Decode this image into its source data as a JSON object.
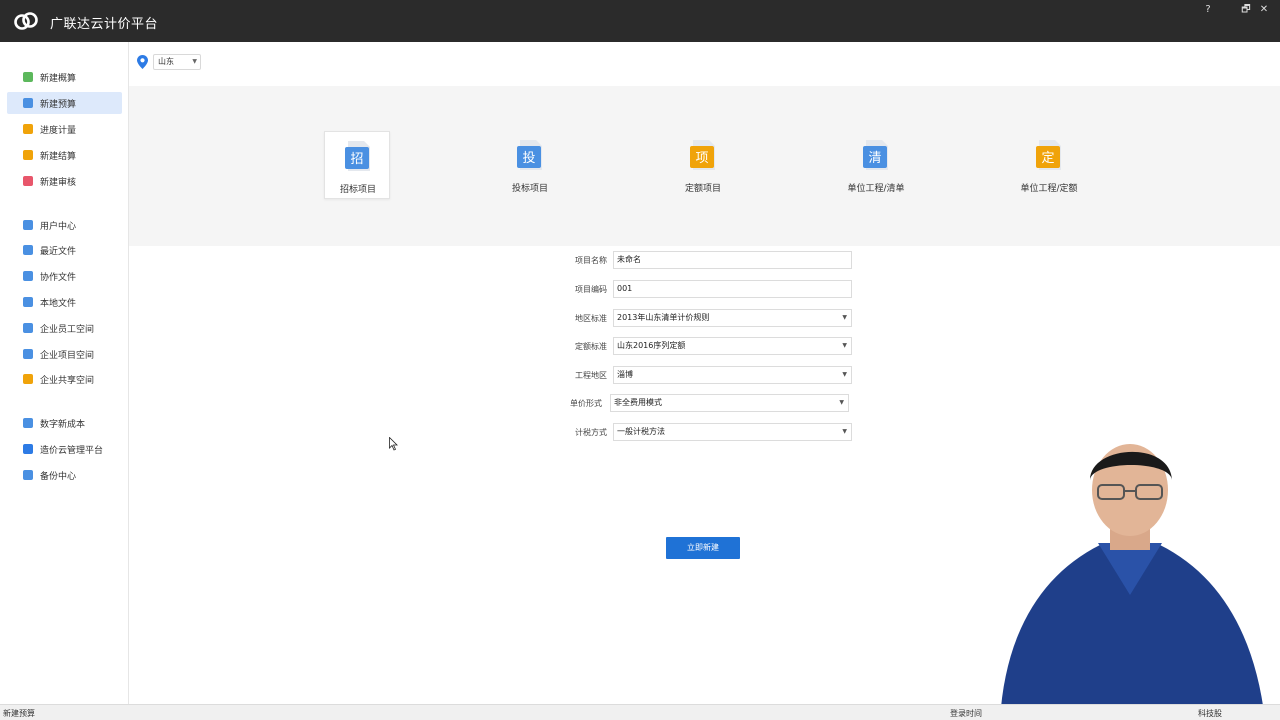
{
  "app": {
    "title": "广联达云计价平台",
    "help_label": "?",
    "restore_label": "🗗",
    "close_label": "✕"
  },
  "sidebar": {
    "items": [
      {
        "label": "新建概算",
        "color": "#5cb85c"
      },
      {
        "label": "新建预算",
        "color": "#4a90e2"
      },
      {
        "label": "进度计量",
        "color": "#f0a30a"
      },
      {
        "label": "新建结算",
        "color": "#f0a30a"
      },
      {
        "label": "新建审核",
        "color": "#e8566b"
      },
      {
        "label": "用户中心",
        "color": "#4a90e2"
      },
      {
        "label": "最近文件",
        "color": "#4a90e2"
      },
      {
        "label": "协作文件",
        "color": "#4a90e2"
      },
      {
        "label": "本地文件",
        "color": "#4a90e2"
      },
      {
        "label": "企业员工空间",
        "color": "#4a90e2"
      },
      {
        "label": "企业项目空间",
        "color": "#4a90e2"
      },
      {
        "label": "企业共享空间",
        "color": "#f0a30a"
      },
      {
        "label": "数字新成本",
        "color": "#4a90e2"
      },
      {
        "label": "造价云管理平台",
        "color": "#2d7be5"
      },
      {
        "label": "备份中心",
        "color": "#4a90e2"
      }
    ]
  },
  "region": {
    "selected": "山东",
    "arrow": "▼"
  },
  "project_types": [
    {
      "label": "招标项目",
      "glyph": "招",
      "color": "#4a90e2"
    },
    {
      "label": "投标项目",
      "glyph": "投",
      "color": "#4a90e2"
    },
    {
      "label": "定额项目",
      "glyph": "项",
      "color": "#f0a30a"
    },
    {
      "label": "单位工程/清单",
      "glyph": "清",
      "color": "#4a90e2"
    },
    {
      "label": "单位工程/定额",
      "glyph": "定",
      "color": "#f0a30a"
    }
  ],
  "form": {
    "fields": [
      {
        "label": "项目名称",
        "value": "未命名",
        "dropdown": false
      },
      {
        "label": "项目编码",
        "value": "001",
        "dropdown": false
      },
      {
        "label": "地区标准",
        "value": "2013年山东清单计价规则",
        "dropdown": true
      },
      {
        "label": "定额标准",
        "value": "山东2016序列定额",
        "dropdown": true
      },
      {
        "label": "工程地区",
        "value": "淄博",
        "dropdown": true
      },
      {
        "label": "单价形式",
        "value": "非全费用模式",
        "dropdown": true
      },
      {
        "label": "计税方式",
        "value": "一般计税方法",
        "dropdown": true
      }
    ],
    "arrow": "▼",
    "create_button": "立即新建"
  },
  "statusbar": {
    "left": "新建预算",
    "mid": "登录时间",
    "right": "科技股"
  }
}
